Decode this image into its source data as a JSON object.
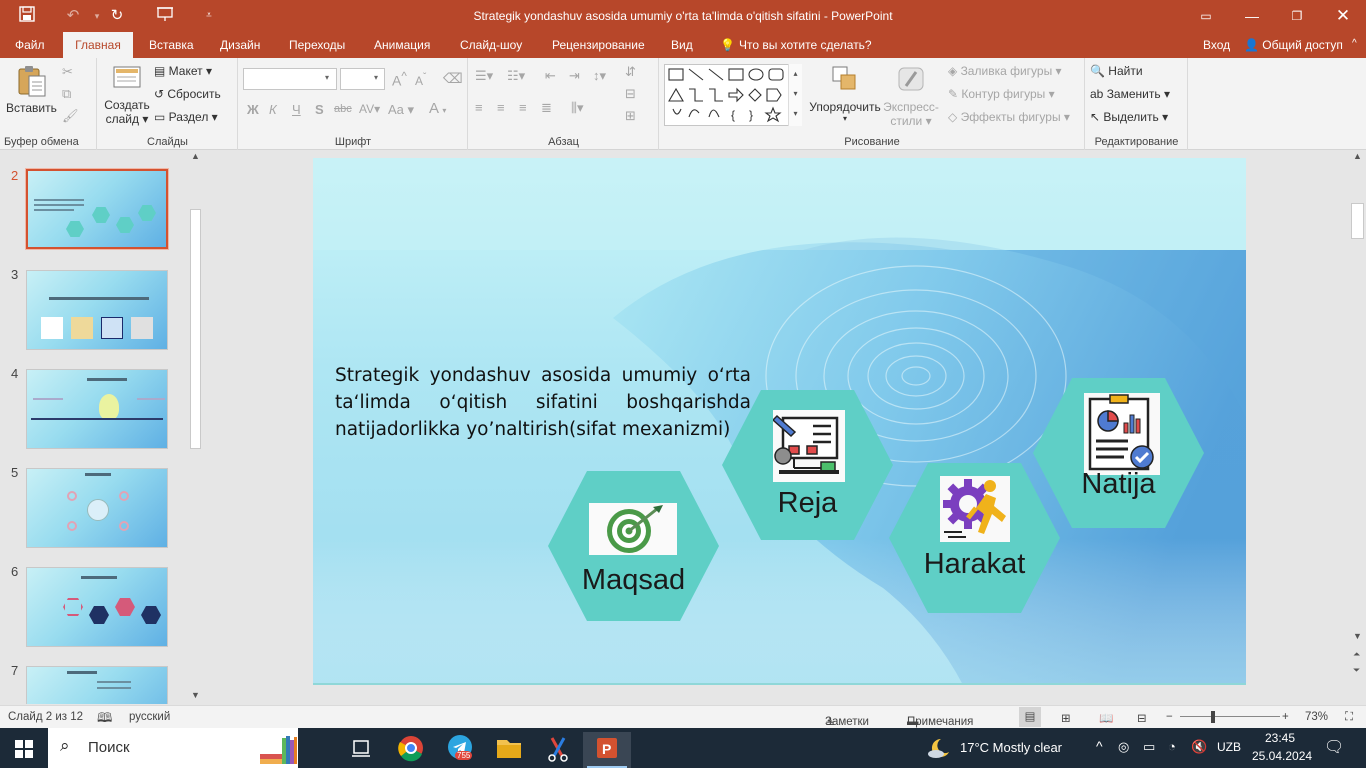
{
  "app": {
    "window_title": "Strategik yondashuv asosida umumiy o'rta ta'limda o'qitish sifatini - PowerPoint"
  },
  "tabs": [
    {
      "label": "Файл"
    },
    {
      "label": "Главная"
    },
    {
      "label": "Вставка"
    },
    {
      "label": "Дизайн"
    },
    {
      "label": "Переходы"
    },
    {
      "label": "Анимация"
    },
    {
      "label": "Слайд-шоу"
    },
    {
      "label": "Рецензирование"
    },
    {
      "label": "Вид"
    }
  ],
  "tell_me": "Что вы хотите сделать?",
  "account": {
    "signin": "Вход",
    "share": "Общий доступ"
  },
  "ribbon": {
    "clipboard": {
      "group": "Буфер обмена",
      "paste": "Вставить"
    },
    "slides": {
      "group": "Слайды",
      "new_slide_1": "Создать",
      "new_slide_2": "слайд",
      "layout": "Макет",
      "reset": "Сбросить",
      "section": "Раздел"
    },
    "font": {
      "group": "Шрифт",
      "bold": "Ж",
      "italic": "К",
      "underline": "Ч",
      "shadow": "S",
      "strike": "abc",
      "spacing": "AV",
      "case": "Aa",
      "grow": "A",
      "shrink": "A",
      "color": "A"
    },
    "paragraph": {
      "group": "Абзац"
    },
    "drawing": {
      "group": "Рисование",
      "arrange": "Упорядочить",
      "quick_styles_1": "Экспресс-",
      "quick_styles_2": "стили",
      "fill": "Заливка фигуры",
      "outline": "Контур фигуры",
      "effects": "Эффекты фигуры"
    },
    "editing": {
      "group": "Редактирование",
      "find": "Найти",
      "replace": "Заменить",
      "select": "Выделить"
    }
  },
  "thumbnails": [
    {
      "number": "2"
    },
    {
      "number": "3"
    },
    {
      "number": "4"
    },
    {
      "number": "5"
    },
    {
      "number": "6"
    },
    {
      "number": "7"
    }
  ],
  "slide": {
    "text": "Strategik yondashuv asosida umumiy o‘rta ta‘limda o‘qitish sifatini boshqarishda natijadorlikka yo’naltirish(sifat mexanizmi)",
    "hexagons": [
      {
        "label": "Maqsad",
        "icon": "target-icon"
      },
      {
        "label": "Reja",
        "icon": "plan-icon"
      },
      {
        "label": "Harakat",
        "icon": "running-gear-icon"
      },
      {
        "label": "Natija",
        "icon": "report-icon"
      }
    ],
    "colors": {
      "hex_fill": "#5fcfc6",
      "accent": "#b7472a"
    }
  },
  "status": {
    "slide_of": "Слайд 2 из 12",
    "language": "русский",
    "notes": "Заметки",
    "comments": "Примечания",
    "zoom": "73%"
  },
  "taskbar": {
    "search": "Поиск",
    "weather": "17°C  Mostly clear",
    "lang": "UZB",
    "time": "23:45",
    "date": "25.04.2024",
    "telegram_badge": "755"
  }
}
